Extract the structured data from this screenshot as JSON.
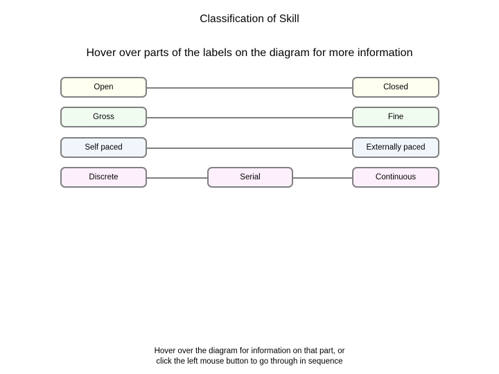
{
  "page": {
    "title": "Classification of Skill",
    "subtitle": "Hover over parts of the labels on the diagram for more information"
  },
  "footer": {
    "line1": "Hover over the diagram for information on that part, or",
    "line2": "click the left mouse button to go through in sequence"
  },
  "colors": {
    "border": "#808080",
    "connector": "#7f7f7f",
    "fill_cream": "#fffff0",
    "fill_mint": "#f1fcf1",
    "fill_blue": "#f0f6fc",
    "fill_pink": "#fdf0fc",
    "background": "#ffffff",
    "text": "#000000"
  },
  "diagram": {
    "type": "continuum-chart",
    "rows": [
      {
        "id": "open-closed",
        "fill": "cream",
        "nodes": [
          {
            "label": "Open",
            "position": "left"
          },
          {
            "label": "Closed",
            "position": "right"
          }
        ]
      },
      {
        "id": "gross-fine",
        "fill": "mint",
        "nodes": [
          {
            "label": "Gross",
            "position": "left"
          },
          {
            "label": "Fine",
            "position": "right"
          }
        ]
      },
      {
        "id": "self-externally-paced",
        "fill": "blue",
        "nodes": [
          {
            "label": "Self paced",
            "position": "left"
          },
          {
            "label": "Externally paced",
            "position": "right"
          }
        ]
      },
      {
        "id": "discrete-serial-continuous",
        "fill": "pink",
        "nodes": [
          {
            "label": "Discrete",
            "position": "left"
          },
          {
            "label": "Serial",
            "position": "middle"
          },
          {
            "label": "Continuous",
            "position": "right"
          }
        ]
      }
    ]
  }
}
